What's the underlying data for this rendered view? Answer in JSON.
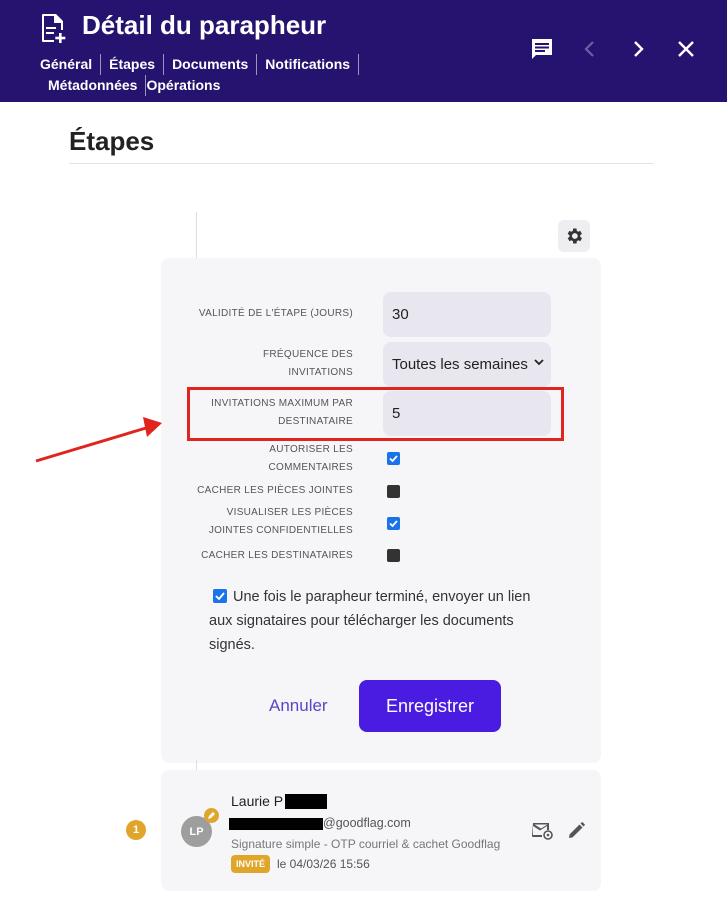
{
  "header": {
    "title": "Détail du parapheur",
    "tabs": [
      "Général",
      "Étapes",
      "Documents",
      "Notifications",
      "Métadonnées",
      "Opérations"
    ]
  },
  "section": {
    "title": "Étapes"
  },
  "settings": {
    "validity_label": "Validité de l'étape (jours)",
    "validity_value": "30",
    "frequency_label": "Fréquence des invitations",
    "frequency_value": "Toutes les semaines",
    "max_invitations_label": "Invitations maximum par destinataire",
    "max_invitations_value": "5",
    "allow_comments_label": "Autoriser les commentaires",
    "allow_comments": true,
    "hide_attachments_label": "Cacher les pièces jointes",
    "hide_attachments": false,
    "view_confidential_label": "Visualiser les pièces jointes confidentielles",
    "view_confidential": true,
    "hide_recipients_label": "Cacher les destinataires",
    "hide_recipients": false,
    "send_link_label": "Une fois le parapheur terminé, envoyer un lien aux signataires pour télécharger les documents signés.",
    "send_link": true,
    "cancel_label": "Annuler",
    "save_label": "Enregistrer"
  },
  "signer": {
    "step_number": "1",
    "initials": "LP",
    "name": "Laurie P",
    "email": "@goodflag.com",
    "signature_type": "Signature simple - OTP courriel & cachet Goodflag",
    "status": "INVITÉ",
    "date": "le 04/03/26 15:56"
  },
  "colors": {
    "header": "#25136f",
    "accent": "#4a1be0",
    "highlight": "#e0241e",
    "badge": "#e0a62c"
  }
}
